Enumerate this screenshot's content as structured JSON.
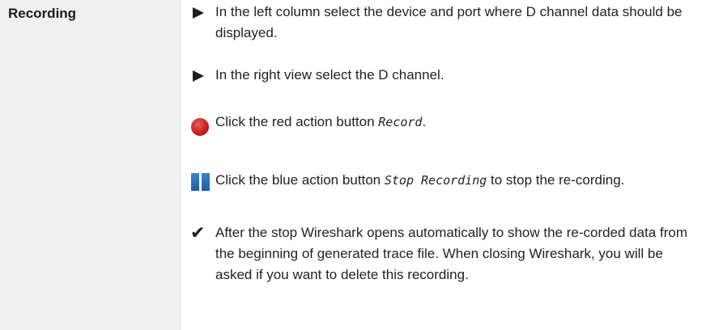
{
  "sidebar": {
    "title": "Recording"
  },
  "steps": {
    "step1": {
      "icon": "triangle-bullet-icon",
      "text": "In the left column select the device and port where D channel data should be displayed."
    },
    "step2": {
      "icon": "triangle-bullet-icon",
      "text": "In the right view select the D channel."
    },
    "step3": {
      "icon": "record-icon",
      "text_before": "Click the red action button ",
      "term": "Record",
      "text_after": "."
    },
    "step4": {
      "icon": "stop-recording-icon",
      "text_before": "Click the blue action button ",
      "term": "Stop Recording",
      "text_after": " to stop the re-cording."
    },
    "result": {
      "icon": "checkmark-icon",
      "text": "After the stop Wireshark opens automatically to show the re-corded data from the beginning of generated trace file. When closing Wireshark, you will be asked if you want to delete this recording."
    }
  },
  "colors": {
    "sidebar_bg": "#f0f0f0",
    "record_red": "#c81e1e",
    "stop_blue": "#1d5ea4"
  }
}
